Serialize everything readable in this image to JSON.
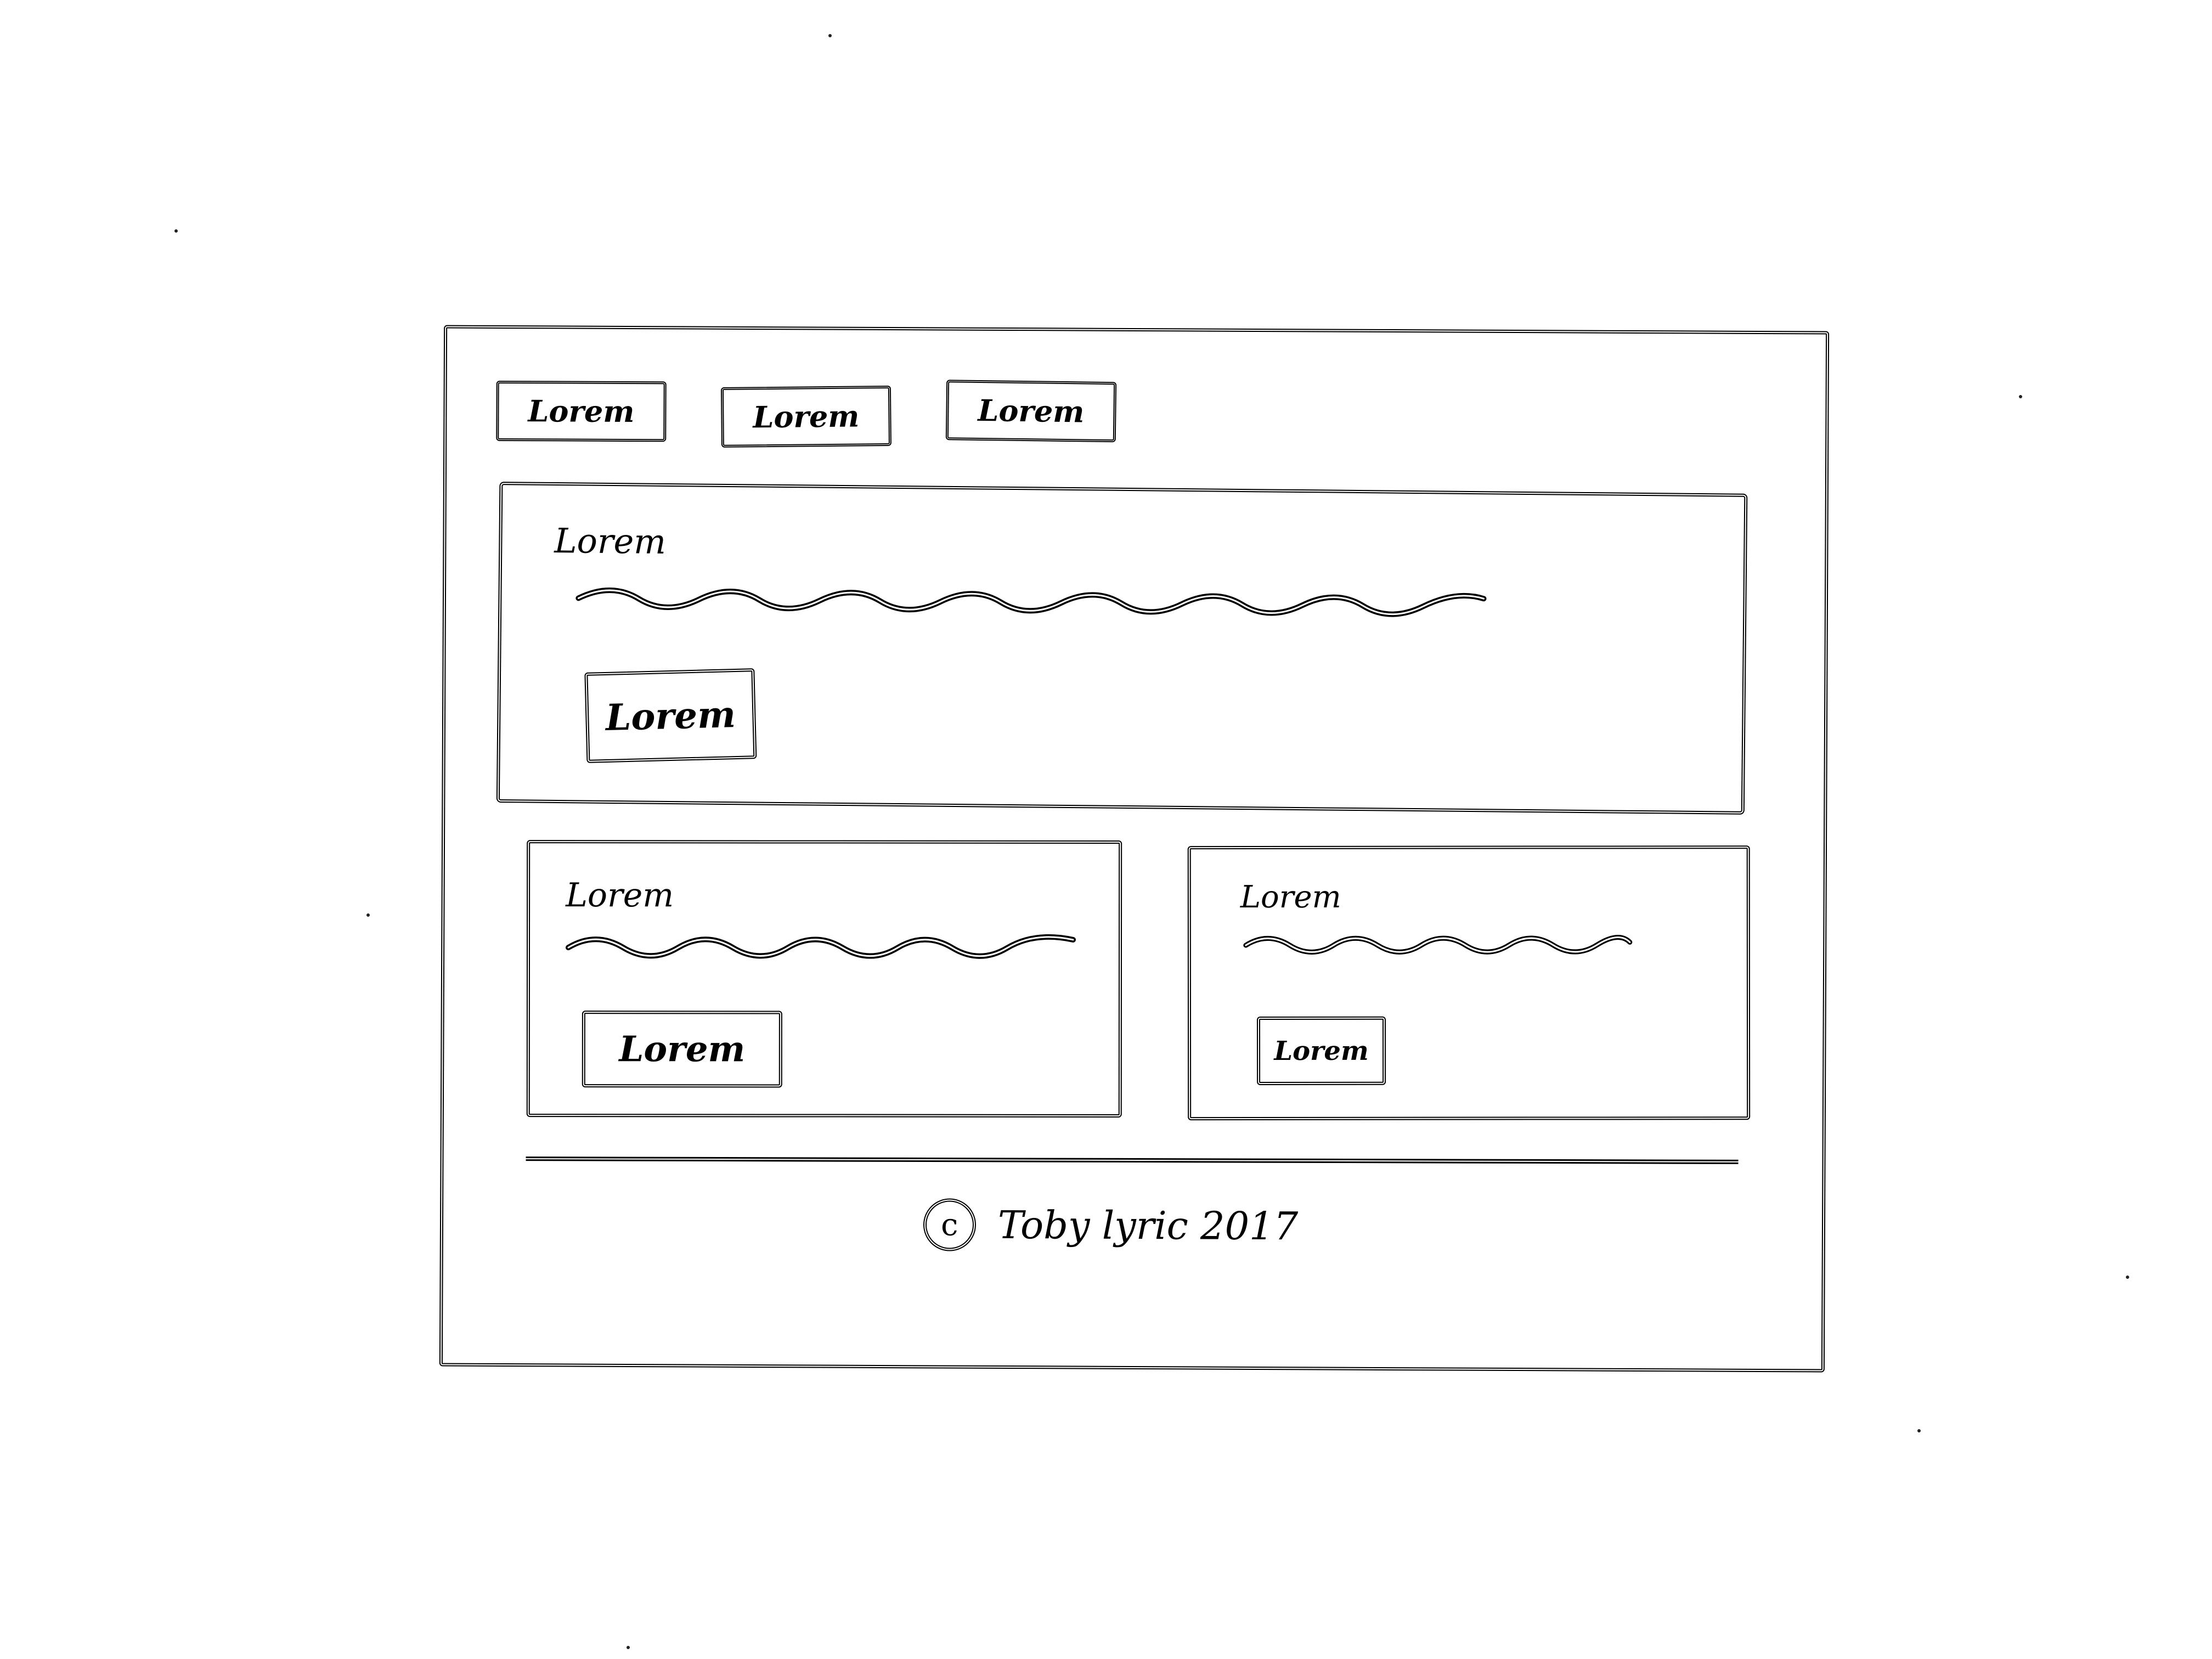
{
  "nav": {
    "items": [
      {
        "label": "Lorem"
      },
      {
        "label": "Lorem"
      },
      {
        "label": "Lorem"
      }
    ]
  },
  "hero": {
    "title": "Lorem",
    "button_label": "Lorem"
  },
  "cards": [
    {
      "title": "Lorem",
      "button_label": "Lorem"
    },
    {
      "title": "Lorem",
      "button_label": "Lorem"
    }
  ],
  "footer": {
    "copyright_symbol": "c",
    "text": "Toby lyric 2017"
  }
}
